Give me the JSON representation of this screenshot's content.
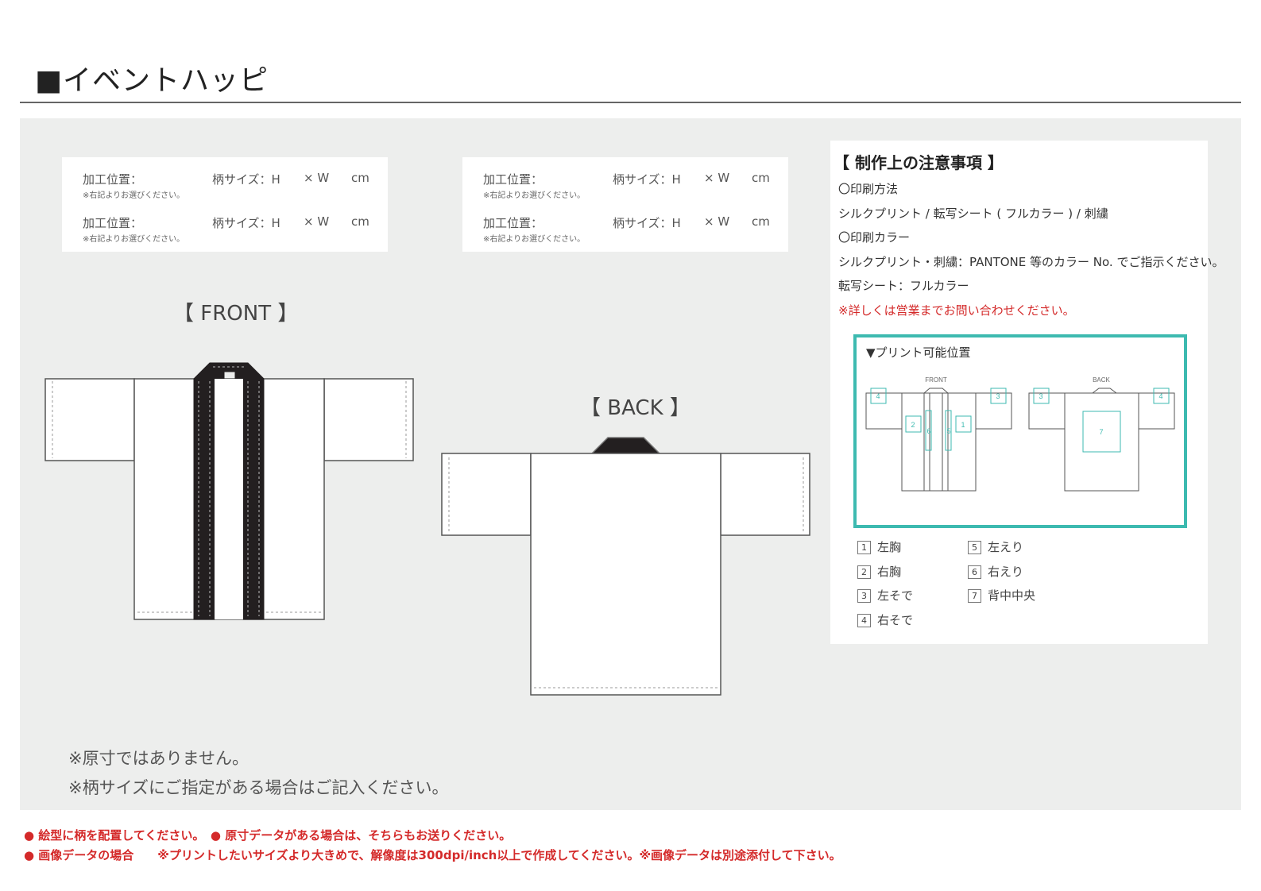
{
  "title": "■イベントハッピ",
  "spec_boxes": [
    {
      "rows": [
        {
          "label": "加工位置：",
          "note": "※右記よりお選びください。",
          "size_label": "柄サイズ：H",
          "width_label": "× W",
          "unit": "cm"
        },
        {
          "label": "加工位置：",
          "note": "※右記よりお選びください。",
          "size_label": "柄サイズ：H",
          "width_label": "× W",
          "unit": "cm"
        }
      ]
    },
    {
      "rows": [
        {
          "label": "加工位置：",
          "note": "※右記よりお選びください。",
          "size_label": "柄サイズ：H",
          "width_label": "× W",
          "unit": "cm"
        },
        {
          "label": "加工位置：",
          "note": "※右記よりお選びください。",
          "size_label": "柄サイズ：H",
          "width_label": "× W",
          "unit": "cm"
        }
      ]
    }
  ],
  "front_label": "【 FRONT 】",
  "back_label": "【 BACK 】",
  "notes": {
    "heading": "【 制作上の注意事項 】",
    "method_heading": "〇印刷方法",
    "method_text": "シルクプリント / 転写シート ( フルカラー ) / 刺繍",
    "color_heading": "〇印刷カラー",
    "color_text": "シルクプリント・刺繍：PANTONE 等のカラー No. でご指示ください。",
    "transfer_text": "転写シート：フルカラー",
    "contact_text": "※詳しくは営業までお問い合わせください。"
  },
  "print_area": {
    "title": "▼プリント可能位置",
    "front_caption": "FRONT",
    "back_caption": "BACK",
    "accent_color": "#3dbab0"
  },
  "legend": [
    {
      "num": "1",
      "label": "左胸"
    },
    {
      "num": "2",
      "label": "右胸"
    },
    {
      "num": "3",
      "label": "左そで"
    },
    {
      "num": "4",
      "label": "右そで"
    },
    {
      "num": "5",
      "label": "左えり"
    },
    {
      "num": "6",
      "label": "右えり"
    },
    {
      "num": "7",
      "label": "背中中央"
    }
  ],
  "footnotes": [
    "※原寸ではありません。",
    "※柄サイズにご指定がある場合はご記入ください。"
  ],
  "warnings": [
    "● 絵型に柄を配置してください。　● 原寸データがある場合は、そちらもお送りください。",
    "● 画像データの場合　　※プリントしたいサイズより大きめで、解像度は300dpi/inch以上で作成してください。※画像データは別途添付して下さい。"
  ]
}
